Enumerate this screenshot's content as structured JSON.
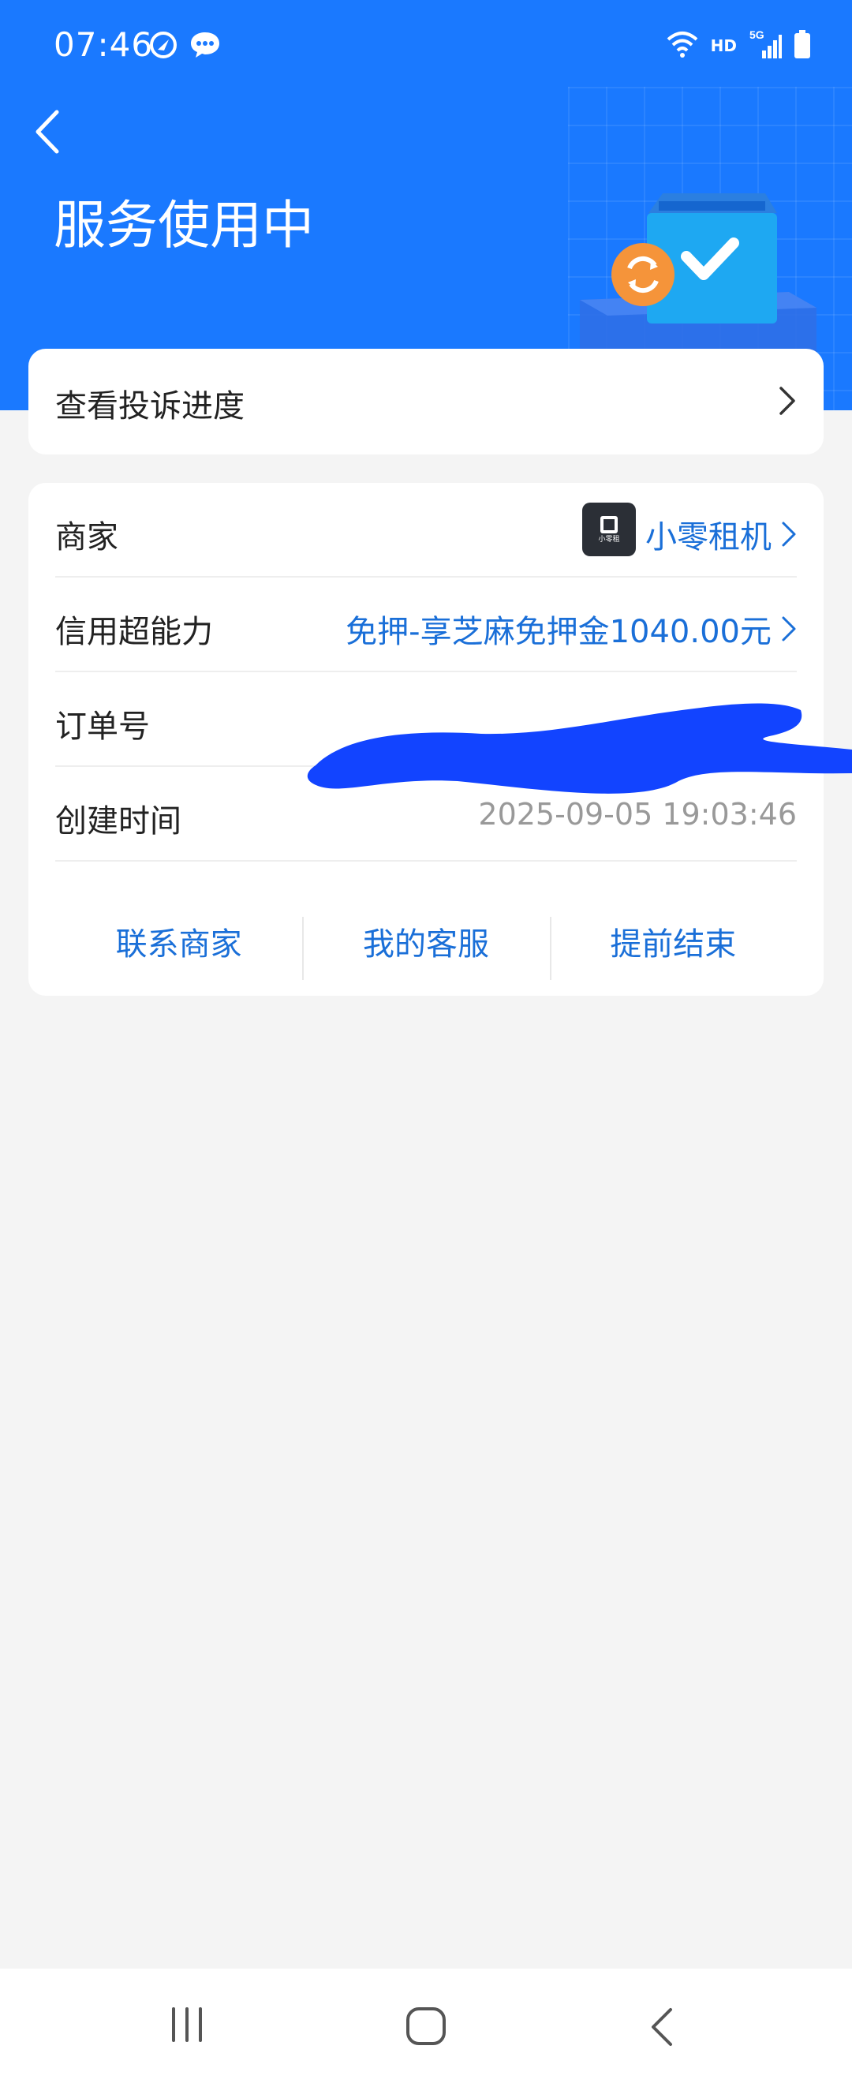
{
  "status_bar": {
    "time": "07:46",
    "hd": "HD",
    "network": "5G"
  },
  "header": {
    "title": "服务使用中"
  },
  "complaint": {
    "label": "查看投诉进度"
  },
  "info": {
    "merchant_label": "商家",
    "merchant_value": "小零租机",
    "merchant_logo_text": "小零租",
    "credit_label": "信用超能力",
    "credit_value": "免押-享芝麻免押金1040.00元",
    "order_label": "订单号",
    "created_label": "创建时间",
    "created_value": "2025-09-05 19:03:46"
  },
  "actions": {
    "contact": "联系商家",
    "service": "我的客服",
    "end": "提前结束"
  },
  "colors": {
    "header_bg": "#1a79ff",
    "link": "#1a6fd8",
    "redaction": "#1244ff"
  }
}
